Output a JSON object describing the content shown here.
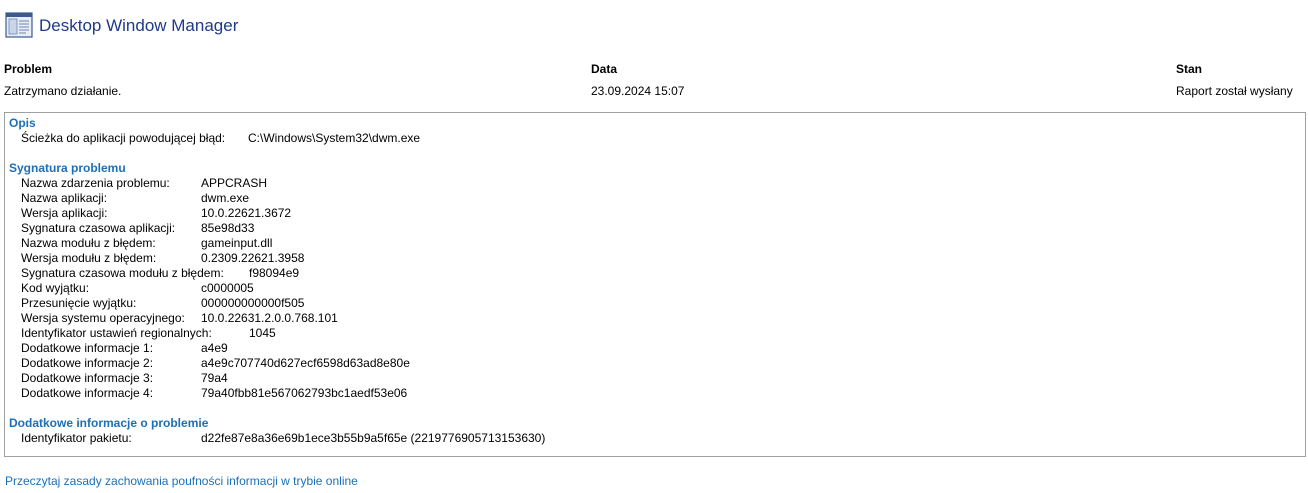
{
  "window": {
    "title": "Desktop Window Manager",
    "icon": "report-window-icon"
  },
  "summary": {
    "problem_header": "Problem",
    "problem_value": "Zatrzymano działanie.",
    "date_header": "Data",
    "date_value": "23.09.2024 15:07",
    "status_header": "Stan",
    "status_value": "Raport został wysłany"
  },
  "description": {
    "title": "Opis",
    "rows": [
      {
        "label": "Ścieżka do aplikacji powodującej błąd:",
        "value": "C:\\Windows\\System32\\dwm.exe"
      }
    ]
  },
  "signature": {
    "title": "Sygnatura problemu",
    "rows": [
      {
        "label": "Nazwa zdarzenia problemu:",
        "value": "APPCRASH"
      },
      {
        "label": "Nazwa aplikacji:",
        "value": "dwm.exe"
      },
      {
        "label": "Wersja aplikacji:",
        "value": "10.0.22621.3672"
      },
      {
        "label": "Sygnatura czasowa aplikacji:",
        "value": "85e98d33"
      },
      {
        "label": "Nazwa modułu z błędem:",
        "value": "gameinput.dll"
      },
      {
        "label": "Wersja modułu z błędem:",
        "value": "0.2309.22621.3958"
      },
      {
        "label": "Sygnatura czasowa modułu z błędem:",
        "value": "f98094e9"
      },
      {
        "label": "Kod wyjątku:",
        "value": "c0000005"
      },
      {
        "label": "Przesunięcie wyjątku:",
        "value": "000000000000f505"
      },
      {
        "label": "Wersja systemu operacyjnego:",
        "value": "10.0.22631.2.0.0.768.101"
      },
      {
        "label": "Identyfikator ustawień regionalnych:",
        "value": "1045"
      },
      {
        "label": "Dodatkowe informacje 1:",
        "value": "a4e9"
      },
      {
        "label": "Dodatkowe informacje 2:",
        "value": "a4e9c707740d627ecf6598d63ad8e80e"
      },
      {
        "label": "Dodatkowe informacje 3:",
        "value": "79a4"
      },
      {
        "label": "Dodatkowe informacje 4:",
        "value": "79a40fbb81e567062793bc1aedf53e06"
      }
    ]
  },
  "extra": {
    "title": "Dodatkowe informacje o problemie",
    "rows": [
      {
        "label": "Identyfikator pakietu:",
        "value": "d22fe87e8a36e69b1ece3b55b9a5f65e (2219776905713153630)"
      }
    ]
  },
  "footer": {
    "privacy_link": "Przeczytaj zasady zachowania poufności informacji w trybie online"
  },
  "colors": {
    "link": "#1d6fb8",
    "title": "#1e3a8a",
    "border": "#a0a0a0"
  }
}
